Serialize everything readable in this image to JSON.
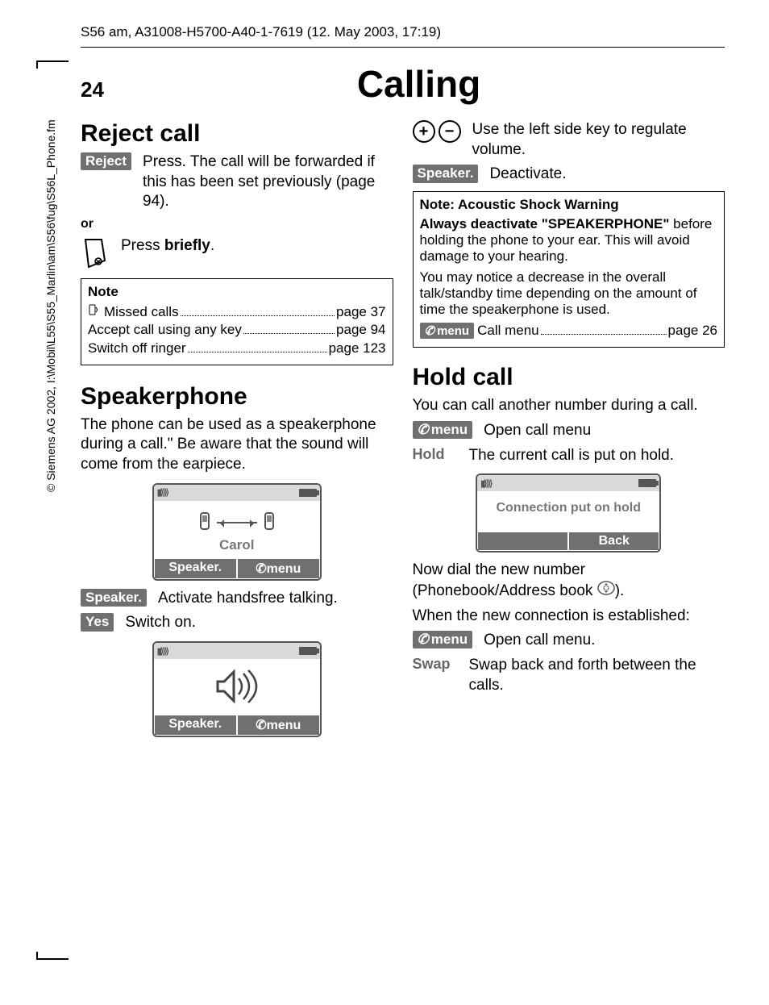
{
  "meta": {
    "header": "S56 am, A31008-H5700-A40-1-7619 (12. May 2003, 17:19)"
  },
  "page": {
    "number": "24",
    "title": "Calling"
  },
  "sidebar_copyright": "© Siemens AG 2002, I:\\Mobil\\L55\\S55_Marlin\\am\\S56\\fug\\S56L_Phone.fm",
  "left": {
    "reject": {
      "heading": "Reject call",
      "key": "Reject",
      "desc": "Press. The call will be forwarded if this has been set previously (page 94).",
      "or": "or",
      "press_briefly_pre": "Press ",
      "press_briefly_bold": "briefly",
      "press_briefly_post": "."
    },
    "note": {
      "title": "Note",
      "items": [
        {
          "label": "Missed calls",
          "page": "page 37",
          "icon": true
        },
        {
          "label": "Accept call using any key",
          "page": "page 94",
          "icon": false
        },
        {
          "label": "Switch off ringer",
          "page": "page 123",
          "icon": false
        }
      ]
    },
    "speaker": {
      "heading": "Speakerphone",
      "intro": "The phone can be used as a speakerphone during a call.\" Be aware that the sound will come from the earpiece.",
      "screen1": {
        "name": "Carol",
        "soft_left": "Speaker.",
        "soft_right": "menu"
      },
      "row_speaker": {
        "key": "Speaker.",
        "desc": "Activate handsfree talking."
      },
      "row_yes": {
        "key": "Yes",
        "desc": "Switch on."
      },
      "screen2": {
        "soft_left": "Speaker.",
        "soft_right": "menu"
      }
    }
  },
  "right": {
    "volume": {
      "desc": "Use the left side key to regulate volume."
    },
    "speaker_off": {
      "key": "Speaker.",
      "desc": "Deactivate."
    },
    "warn": {
      "title": "Note: Acoustic Shock Warning",
      "line1_bold": "Always deactivate \"SPEAKERPHONE\"",
      "line1_rest": " before holding the phone to your ear. This will avoid damage to your hearing.",
      "line2": "You may notice a decrease in the overall talk/standby time depending on the amount of time the speakerphone is used.",
      "menu_key": "menu",
      "menu_label": "Call menu",
      "menu_page": "page 26"
    },
    "hold": {
      "heading": "Hold call",
      "intro": "You can call another number during a call.",
      "row_menu": {
        "key": "menu",
        "desc": "Open call menu"
      },
      "row_hold": {
        "key": "Hold",
        "desc": "The current call is put on hold."
      },
      "screen": {
        "msg": "Connection put on hold",
        "soft_right": "Back"
      },
      "post1": "Now dial the new number (Phonebook/Address book ",
      "post1_end": ").",
      "post2": "When the new connection is established:",
      "row_menu2": {
        "key": "menu",
        "desc": "Open call menu."
      },
      "row_swap": {
        "key": "Swap",
        "desc": "Swap back and forth between the calls."
      }
    }
  }
}
